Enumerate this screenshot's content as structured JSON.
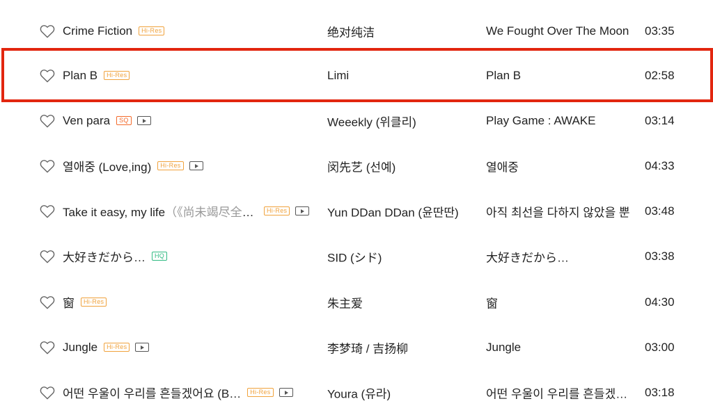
{
  "songs": [
    {
      "title": "Crime Fiction",
      "subtitle": "",
      "badges": [
        "Hi-Res"
      ],
      "mv": false,
      "artist": "绝对纯洁",
      "album": "We Fought Over The Moon",
      "duration": "03:35"
    },
    {
      "title": "Plan B",
      "subtitle": "",
      "badges": [
        "Hi-Res"
      ],
      "mv": false,
      "artist": "Limi",
      "album": "Plan B",
      "duration": "02:58"
    },
    {
      "title": "Ven para",
      "subtitle": "",
      "badges": [
        "SQ"
      ],
      "mv": true,
      "artist": "Weeekly (위클리)",
      "album": "Play Game : AWAKE",
      "duration": "03:14"
    },
    {
      "title": "열애중 (Love,ing)",
      "subtitle": "",
      "badges": [
        "Hi-Res"
      ],
      "mv": true,
      "artist": "闵先艺 (선예)",
      "album": "열애중",
      "duration": "04:33"
    },
    {
      "title": "Take it easy, my life",
      "subtitle": "（《尚未竭尽全力》韩剧插曲）",
      "badges": [
        "Hi-Res"
      ],
      "mv": true,
      "artist": "Yun DDan DDan (윤딴딴)",
      "album": "아직 최선을 다하지 않았을 뿐",
      "duration": "03:48"
    },
    {
      "title": "大好きだから…",
      "subtitle": "",
      "badges": [
        "HQ"
      ],
      "mv": false,
      "artist": "SID (シド)",
      "album": "大好きだから…",
      "duration": "03:38"
    },
    {
      "title": "窗",
      "subtitle": "",
      "badges": [
        "Hi-Res"
      ],
      "mv": false,
      "artist": "朱主爱",
      "album": "窗",
      "duration": "04:30"
    },
    {
      "title": "Jungle",
      "subtitle": "",
      "badges": [
        "Hi-Res"
      ],
      "mv": true,
      "artist": "李梦琦 / 吉扬柳",
      "album": "Jungle",
      "duration": "03:00"
    },
    {
      "title": "어떤 우울이 우리를 흔들겠어요 (B…",
      "subtitle": "",
      "badges": [
        "Hi-Res"
      ],
      "mv": true,
      "artist": "Youra (유라)",
      "album": "어떤 우울이 우리를 흔들겠어요",
      "duration": "03:18"
    }
  ],
  "highlighted_row": 1,
  "colors": {
    "highlight": "#e2260f",
    "hires": "#f0a23c",
    "sq": "#f36a2b",
    "hq": "#2fba82"
  },
  "icons": {
    "favorite": "heart-outline-icon",
    "mv": "mv-play-icon"
  }
}
